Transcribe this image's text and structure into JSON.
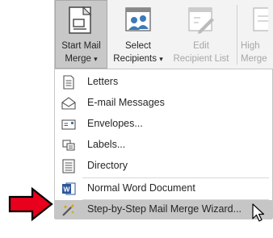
{
  "ribbon": {
    "start_mail_merge": {
      "line1": "Start Mail",
      "line2": "Merge",
      "caret": "▾"
    },
    "select_recipients": {
      "line1": "Select",
      "line2": "Recipients",
      "caret": "▾"
    },
    "edit_recipient_list": {
      "line1": "Edit",
      "line2": "Recipient List"
    },
    "highlight": {
      "line1": "High",
      "line2": "Merge"
    }
  },
  "menu": {
    "items": [
      {
        "label": "Letters",
        "icon": "letter-icon"
      },
      {
        "label": "E-mail Messages",
        "icon": "envelope-open-icon"
      },
      {
        "label": "Envelopes...",
        "icon": "envelope-icon"
      },
      {
        "label": "Labels...",
        "icon": "labels-icon"
      },
      {
        "label": "Directory",
        "icon": "directory-icon"
      },
      {
        "label": "Normal Word Document",
        "icon": "word-icon"
      },
      {
        "label": "Step-by-Step Mail Merge Wizard...",
        "icon": "wizard-icon"
      }
    ]
  },
  "colors": {
    "arrow_fill": "#e8001c",
    "word_blue": "#2b579a",
    "highlight": "#c6c6c6"
  }
}
